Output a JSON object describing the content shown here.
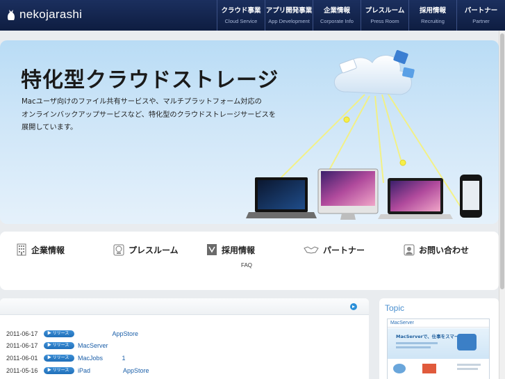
{
  "header": {
    "logo_text": "nekojarashi",
    "nav": [
      {
        "jp": "クラウド事業",
        "en": "Cloud Service"
      },
      {
        "jp": "アプリ開発事業",
        "en": "App Development"
      },
      {
        "jp": "企業情報",
        "en": "Corporate Info"
      },
      {
        "jp": "プレスルーム",
        "en": "Press Room"
      },
      {
        "jp": "採用情報",
        "en": "Recruiting"
      },
      {
        "jp": "パートナー",
        "en": "Partner"
      }
    ]
  },
  "hero": {
    "title": "特化型クラウドストレージ",
    "desc_lines": [
      "Macユーザ向けのファイル共有サービスや、マルチプラットフォーム対応の",
      "オンラインバックアップサービスなど、特化型のクラウドストレージサービスを",
      "展開しています。"
    ]
  },
  "categories": [
    {
      "label": "企業情報",
      "icon": "building-icon"
    },
    {
      "label": "プレスルーム",
      "icon": "press-icon"
    },
    {
      "label": "採用情報",
      "icon": "recruit-icon"
    },
    {
      "label": "パートナー",
      "icon": "handshake-icon"
    },
    {
      "label": "お問い合わせ",
      "icon": "contact-icon"
    }
  ],
  "faq_label": "FAQ",
  "news": {
    "badge_label": "▶ リリース",
    "items": [
      {
        "date": "2011-06-17",
        "text": "                    AppStore"
      },
      {
        "date": "2011-06-17",
        "text": "MacServer"
      },
      {
        "date": "2011-06-01",
        "text": "MacJobs           1"
      },
      {
        "date": "2011-05-16",
        "text": "iPad                   AppStore"
      }
    ]
  },
  "topic": {
    "title": "Topic",
    "thumb_brand": "MacServer",
    "thumb_headline": "MacServerで、仕事をスマートに。"
  },
  "colors": {
    "header_bg": "#1b2f5e",
    "accent_blue": "#2a8fd8",
    "topic_title": "#4a8fcf"
  }
}
